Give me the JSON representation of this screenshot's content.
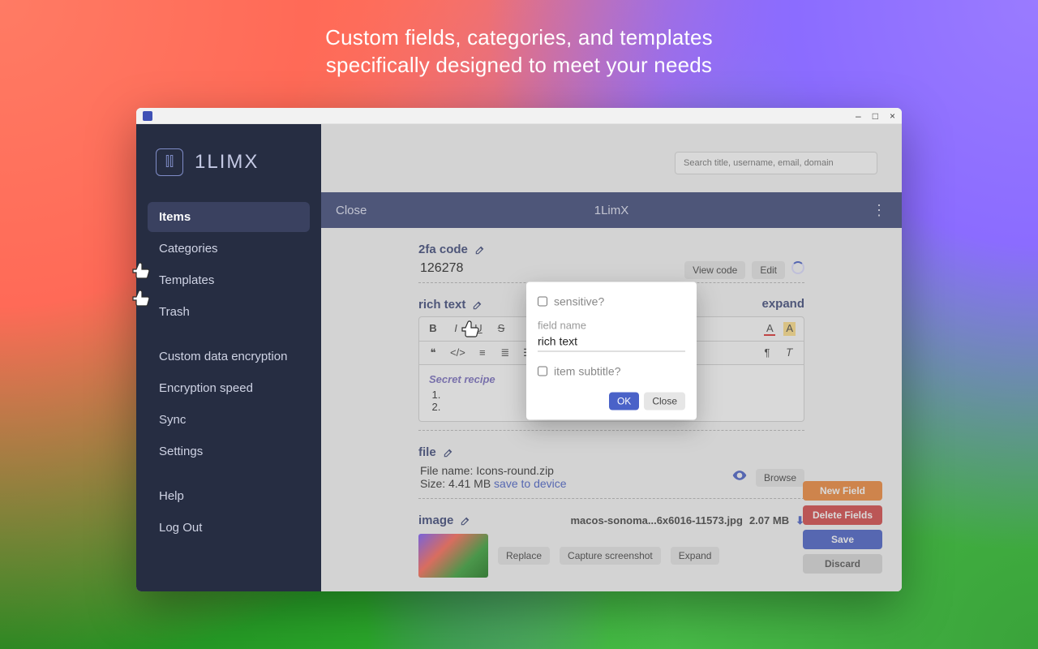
{
  "headline_line1": "Custom fields, categories, and templates",
  "headline_line2": "specifically designed to meet your needs",
  "brand": {
    "name": "1LIMX"
  },
  "window": {
    "minimize": "–",
    "maximize": "□",
    "close": "×"
  },
  "sidebar": {
    "main": [
      {
        "label": "Items",
        "active": true
      },
      {
        "label": "Categories"
      },
      {
        "label": "Templates"
      },
      {
        "label": "Trash"
      }
    ],
    "settings": [
      {
        "label": "Custom data encryption"
      },
      {
        "label": "Encryption speed"
      },
      {
        "label": "Sync"
      },
      {
        "label": "Settings"
      }
    ],
    "footer": [
      {
        "label": "Help"
      },
      {
        "label": "Log Out"
      }
    ]
  },
  "search": {
    "placeholder": "Search title, username, email, domain"
  },
  "subheader": {
    "close": "Close",
    "title": "1LimX",
    "menu": "⋮"
  },
  "fields": {
    "twofa": {
      "label": "2fa code",
      "value": "126278"
    },
    "twofa_chips": {
      "view": "View code",
      "edit": "Edit"
    },
    "richtext": {
      "label": "rich text",
      "expand": "expand",
      "recipe_title": "Secret recipe"
    },
    "rt_toolbar1": [
      "B",
      "I",
      "U",
      "S"
    ],
    "rt_toolbar_right": [
      "A",
      "A"
    ],
    "rt_toolbar2_left": [
      "❝",
      "</>",
      "≡",
      "≣",
      "☰"
    ],
    "rt_toolbar2_right": [
      "¶",
      "𝑇"
    ],
    "file": {
      "label": "file",
      "name_lbl": "File name:",
      "name": "Icons-round.zip",
      "size_lbl": "Size:",
      "size": "4.41 MB",
      "save": "save to device",
      "browse": "Browse"
    },
    "image": {
      "label": "image",
      "filename": "macos-sonoma...6x6016-11573.jpg",
      "size": "2.07 MB",
      "replace": "Replace",
      "capture": "Capture screenshot",
      "expand": "Expand"
    }
  },
  "actions": {
    "new_field": "New Field",
    "delete": "Delete Fields",
    "save": "Save",
    "discard": "Discard"
  },
  "modal": {
    "sensitive": "sensitive?",
    "fieldname_lbl": "field name",
    "fieldname_val": "rich text",
    "subtitle": "item subtitle?",
    "ok": "OK",
    "close": "Close"
  }
}
